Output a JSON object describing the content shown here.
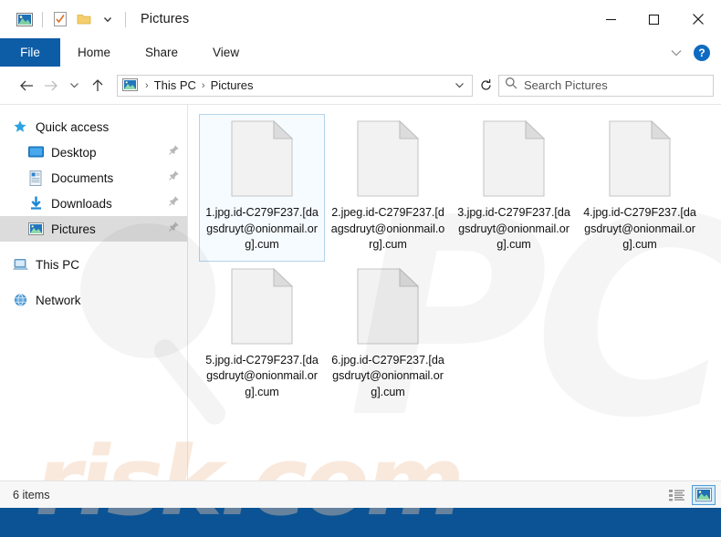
{
  "window": {
    "title": "Pictures",
    "quick_access_icons": [
      "pictures-icon",
      "properties-checklist-icon",
      "new-folder-icon",
      "customize-chevron-icon"
    ],
    "controls": {
      "minimize": "—",
      "maximize": "□",
      "close": "✕"
    }
  },
  "ribbon": {
    "file_label": "File",
    "tabs": [
      "Home",
      "Share",
      "View"
    ],
    "expand_label": "⌄",
    "help_label": "?"
  },
  "navbar": {
    "back": "←",
    "forward": "→",
    "recent": "⌄",
    "up": "↑",
    "breadcrumb": [
      "This PC",
      "Pictures"
    ],
    "breadcrumb_separator": "›",
    "dropdown": "⌄",
    "refresh": "↻"
  },
  "search": {
    "placeholder": "Search Pictures",
    "value": ""
  },
  "sidebar": {
    "items": [
      {
        "label": "Quick access",
        "icon": "star-icon",
        "root": true,
        "pinned": false,
        "selected": false
      },
      {
        "label": "Desktop",
        "icon": "desktop-icon",
        "root": false,
        "pinned": true,
        "selected": false
      },
      {
        "label": "Documents",
        "icon": "documents-icon",
        "root": false,
        "pinned": true,
        "selected": false
      },
      {
        "label": "Downloads",
        "icon": "downloads-icon",
        "root": false,
        "pinned": true,
        "selected": false
      },
      {
        "label": "Pictures",
        "icon": "pictures-icon",
        "root": false,
        "pinned": true,
        "selected": true
      },
      {
        "label": "This PC",
        "icon": "this-pc-icon",
        "root": true,
        "pinned": false,
        "selected": false
      },
      {
        "label": "Network",
        "icon": "network-icon",
        "root": true,
        "pinned": false,
        "selected": false
      }
    ]
  },
  "files": [
    {
      "name": "1.jpg.id-C279F237.[dagsdruyt@onionmail.org].cum",
      "icon": "generic-file-icon",
      "selected": true
    },
    {
      "name": "2.jpeg.id-C279F237.[dagsdruyt@onionmail.org].cum",
      "icon": "generic-file-icon",
      "selected": false
    },
    {
      "name": "3.jpg.id-C279F237.[dagsdruyt@onionmail.org].cum",
      "icon": "generic-file-icon",
      "selected": false
    },
    {
      "name": "4.jpg.id-C279F237.[dagsdruyt@onionmail.org].cum",
      "icon": "generic-file-icon",
      "selected": false
    },
    {
      "name": "5.jpg.id-C279F237.[dagsdruyt@onionmail.org].cum",
      "icon": "generic-file-icon",
      "selected": false
    },
    {
      "name": "6.jpg.id-C279F237.[dagsdruyt@onionmail.org].cum",
      "icon": "generic-file-icon",
      "selected": false
    }
  ],
  "statusbar": {
    "item_count": "6 items",
    "views": [
      {
        "name": "details-view-icon",
        "active": false
      },
      {
        "name": "large-icons-view-icon",
        "active": true
      }
    ]
  },
  "watermarks": {
    "primary": "risk.com",
    "faint": "PCrisk"
  },
  "colors": {
    "window_frame": "#0a5a9c",
    "file_tab": "#0d5ca6",
    "selection_border": "#b5d3ea",
    "selection_fill": "#f5fbff",
    "sidebar_selected": "#dcdcdc",
    "watermark": "#f2c9ab"
  }
}
